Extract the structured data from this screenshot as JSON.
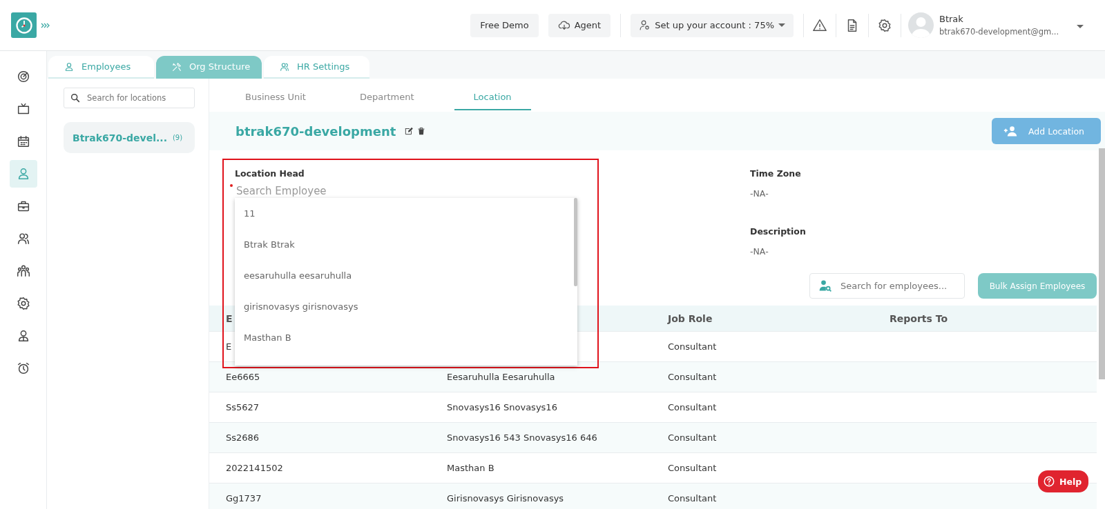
{
  "header": {
    "buttons": [
      {
        "label": "Free Demo",
        "kind": "plain"
      },
      {
        "label": "Agent",
        "kind": "cloud"
      }
    ],
    "setup": {
      "label": "Set up your account : 75%"
    },
    "icons": [
      {
        "kind": "alert"
      },
      {
        "kind": "document"
      },
      {
        "kind": "settings"
      }
    ],
    "user": {
      "name": "Btrak",
      "email": "btrak670-development@gm..."
    }
  },
  "nav": [
    {
      "kind": "target",
      "selected": false
    },
    {
      "kind": "tv",
      "selected": false
    },
    {
      "kind": "calendar",
      "selected": false
    },
    {
      "kind": "person",
      "selected": true
    },
    {
      "kind": "briefcase",
      "selected": false
    },
    {
      "kind": "people",
      "selected": false
    },
    {
      "kind": "team",
      "selected": false
    },
    {
      "kind": "settings",
      "selected": false
    },
    {
      "kind": "user",
      "selected": false
    },
    {
      "kind": "alarm",
      "selected": false
    }
  ],
  "tabs": [
    {
      "label": "Employees",
      "kind": "person",
      "selected": false
    },
    {
      "label": "Org Structure",
      "kind": "tools",
      "selected": true
    },
    {
      "label": "HR Settings",
      "kind": "people",
      "selected": false
    }
  ],
  "location_search": {
    "placeholder": "Search for locations"
  },
  "locations": [
    {
      "name": "Btrak670-devel...",
      "count": "(9)",
      "selected": true
    }
  ],
  "sub_tabs": [
    {
      "label": "Business Unit",
      "selected": false
    },
    {
      "label": "Department",
      "selected": false
    },
    {
      "label": "Location",
      "selected": true
    }
  ],
  "location": {
    "title": "btrak670-development",
    "add_button": "Add Location"
  },
  "location_head": {
    "label": "Location Head",
    "placeholder": "Search Employee",
    "required": true,
    "options": [
      "11",
      "Btrak Btrak",
      "eesaruhulla eesaruhulla",
      "girisnovasys girisnovasys",
      "Masthan B"
    ]
  },
  "details": [
    {
      "label": "Time Zone",
      "value": "-NA-"
    },
    {
      "label": "Description",
      "value": "-NA-"
    }
  ],
  "employee_search": {
    "placeholder": "Search for employees..."
  },
  "bulk_button": "Bulk Assign Employees",
  "table": {
    "columns": {
      "column_1": "E",
      "column_3": "Job Role",
      "column_4": "Reports To"
    },
    "rows": [
      {
        "column_1": "E",
        "column_3": "Consultant"
      },
      {
        "column_1": "Ee6665",
        "column_2": "Eesaruhulla Eesaruhulla",
        "column_3": "Consultant"
      },
      {
        "column_1": "Ss5627",
        "column_2": "Snovasys16 Snovasys16",
        "column_3": "Consultant"
      },
      {
        "column_1": "Ss2686",
        "column_2": "Snovasys16 543 Snovasys16 646",
        "column_3": "Consultant"
      },
      {
        "column_1": "2022141502",
        "column_2": "Masthan B",
        "column_3": "Consultant"
      },
      {
        "column_1": "Gg1737",
        "column_2": "Girisnovasys Girisnovasys",
        "column_3": "Consultant"
      }
    ]
  },
  "help": "Help"
}
